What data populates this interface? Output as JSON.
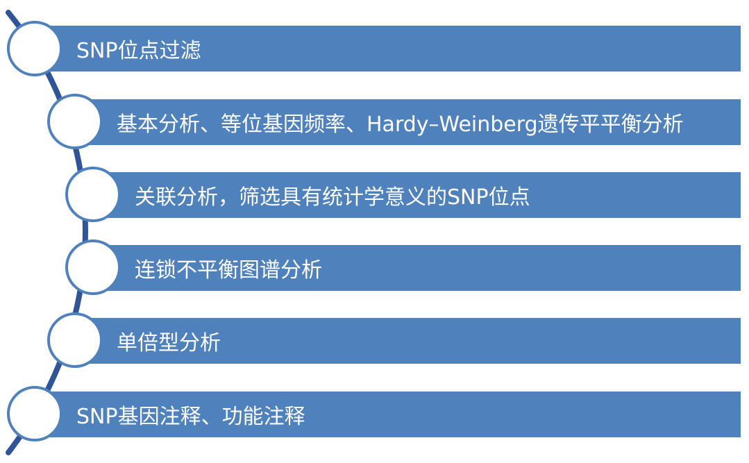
{
  "steps": [
    {
      "label": "SNP位点过滤"
    },
    {
      "label": "基本分析、等位基因频率、Hardy–Weinberg遗传平平衡分析"
    },
    {
      "label": "关联分析，筛选具有统计学意义的SNP位点"
    },
    {
      "label": "连锁不平衡图谱分析"
    },
    {
      "label": "单倍型分析"
    },
    {
      "label": "SNP基因注释、功能注释"
    }
  ],
  "colors": {
    "bar": "#4f81bd",
    "arc": "#2f5597",
    "circle_fill": "#ffffff",
    "text": "#ffffff"
  }
}
